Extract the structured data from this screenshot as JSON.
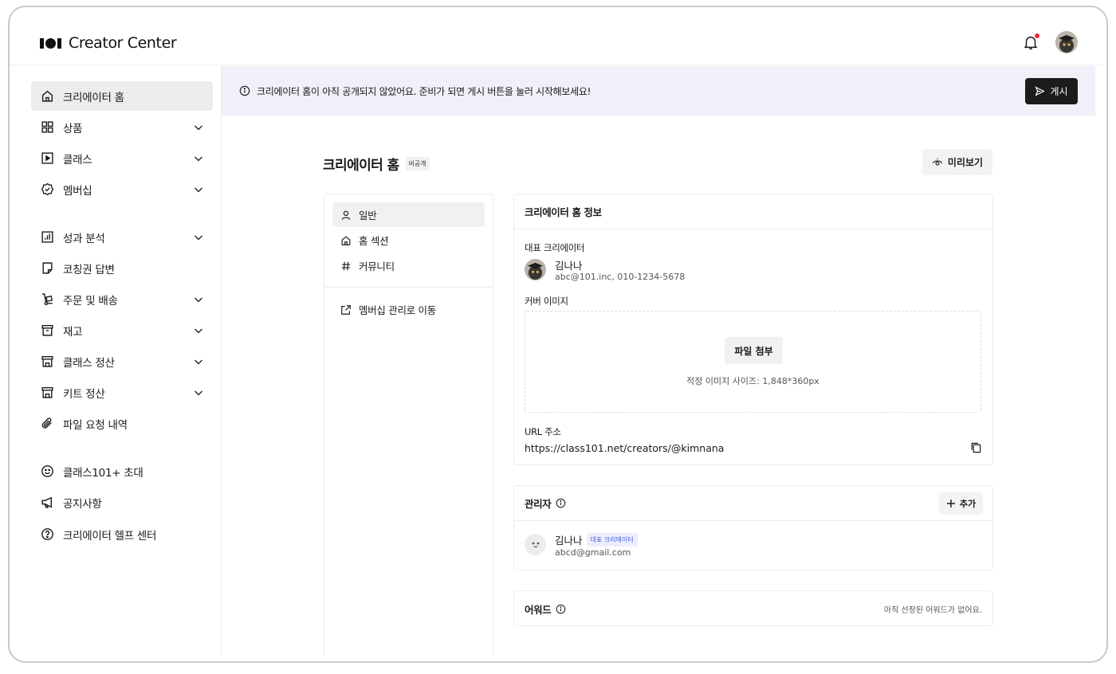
{
  "brand": {
    "name": "Creator Center"
  },
  "header": {
    "notification_icon": "bell-icon",
    "has_unread": true,
    "accent_color": "#f0263c"
  },
  "sidebar": {
    "items": [
      {
        "label": "크리에이터 홈",
        "icon": "home-icon",
        "active": true,
        "expandable": false
      },
      {
        "label": "상품",
        "icon": "grid-icon",
        "active": false,
        "expandable": true
      },
      {
        "label": "클래스",
        "icon": "play-square-icon",
        "active": false,
        "expandable": true
      },
      {
        "label": "멤버십",
        "icon": "badge-check-icon",
        "active": false,
        "expandable": true
      },
      {
        "label": "성과 분석",
        "icon": "bar-chart-icon",
        "active": false,
        "expandable": true
      },
      {
        "label": "코칭권 답변",
        "icon": "note-icon",
        "active": false,
        "expandable": false
      },
      {
        "label": "주문 및 배송",
        "icon": "hand-truck-icon",
        "active": false,
        "expandable": true
      },
      {
        "label": "재고",
        "icon": "archive-icon",
        "active": false,
        "expandable": true
      },
      {
        "label": "클래스 정산",
        "icon": "store-icon",
        "active": false,
        "expandable": true
      },
      {
        "label": "키트 정산",
        "icon": "store-icon",
        "active": false,
        "expandable": true
      },
      {
        "label": "파일 요청 내역",
        "icon": "paperclip-icon",
        "active": false,
        "expandable": false
      },
      {
        "label": "클래스101+ 초대",
        "icon": "smile-icon",
        "active": false,
        "expandable": false
      },
      {
        "label": "공지사항",
        "icon": "megaphone-icon",
        "active": false,
        "expandable": false
      },
      {
        "label": "크리에이터 헬프 센터",
        "icon": "help-circle-icon",
        "active": false,
        "expandable": false
      }
    ]
  },
  "banner": {
    "text": "크리에이터 홈이 아직 공개되지 않았어요. 준비가 되면 게시 버튼을 눌러 시작해보세요!",
    "publish_label": "게시"
  },
  "page": {
    "title": "크리에이터 홈",
    "status_tag": "비공개",
    "preview_label": "미리보기"
  },
  "subnav": {
    "items": [
      {
        "label": "일반",
        "icon": "user-icon",
        "active": true
      },
      {
        "label": "홈 섹션",
        "icon": "home-icon",
        "active": false
      },
      {
        "label": "커뮤니티",
        "icon": "hash-icon",
        "active": false
      }
    ],
    "external": {
      "label": "멤버십 관리로 이동",
      "icon": "external-link-icon"
    }
  },
  "info_card": {
    "title": "크리에이터 홈 정보",
    "rep_label": "대표 크리에이터",
    "rep_name": "김나나",
    "rep_meta": "abc@101.inc, 010-1234-5678",
    "cover_label": "커버 이미지",
    "file_button": "파일 첨부",
    "file_hint": "적정 이미지 사이즈: 1,848*360px",
    "url_label": "URL 주소",
    "url_value": "https://class101.net/creators/@kimnana"
  },
  "admin_card": {
    "title": "관리자",
    "add_label": "추가",
    "admin_name": "김나나",
    "admin_badge": "대표 크리에이터",
    "admin_email": "abcd@gmail.com"
  },
  "word_card": {
    "title": "어워드",
    "empty_text": "아직 선정된 어워드가 없어요."
  }
}
